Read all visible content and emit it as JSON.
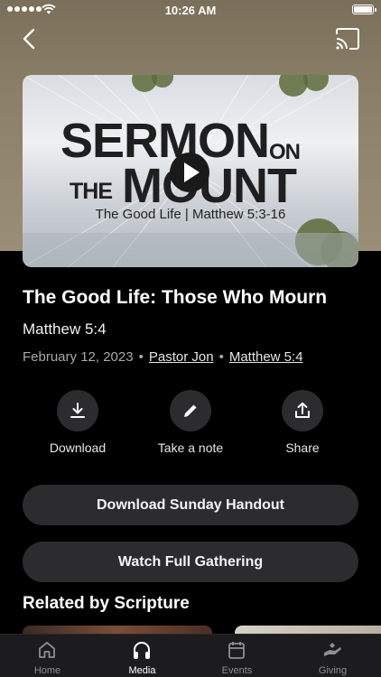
{
  "status_bar": {
    "time": "10:26 AM"
  },
  "artwork": {
    "line1": "SERMON",
    "line1_suffix": "ON",
    "line2_prefix": "THE",
    "line2": "MOUNT",
    "subtitle": "The Good Life | Matthew 5:3-16"
  },
  "sermon": {
    "title": "The Good Life: Those Who Mourn",
    "scripture": "Matthew 5:4",
    "date": "February 12, 2023",
    "speaker": "Pastor Jon",
    "scripture_link": "Matthew 5:4",
    "separator": "•"
  },
  "actions": [
    {
      "label": "Download",
      "icon": "download-icon"
    },
    {
      "label": "Take a note",
      "icon": "pencil-icon"
    },
    {
      "label": "Share",
      "icon": "share-icon"
    }
  ],
  "buttons": {
    "handout": "Download Sunday Handout",
    "gathering": "Watch Full Gathering"
  },
  "related": {
    "heading": "Related by Scripture"
  },
  "tabs": [
    {
      "label": "Home",
      "icon": "home-icon"
    },
    {
      "label": "Media",
      "icon": "headphones-icon"
    },
    {
      "label": "Events",
      "icon": "calendar-icon"
    },
    {
      "label": "Giving",
      "icon": "giving-hand-icon"
    }
  ],
  "colors": {
    "background": "#000000",
    "surface": "#2c2c2e",
    "muted_text": "#a9a9a9",
    "tabbar": "#1c1c1e"
  }
}
